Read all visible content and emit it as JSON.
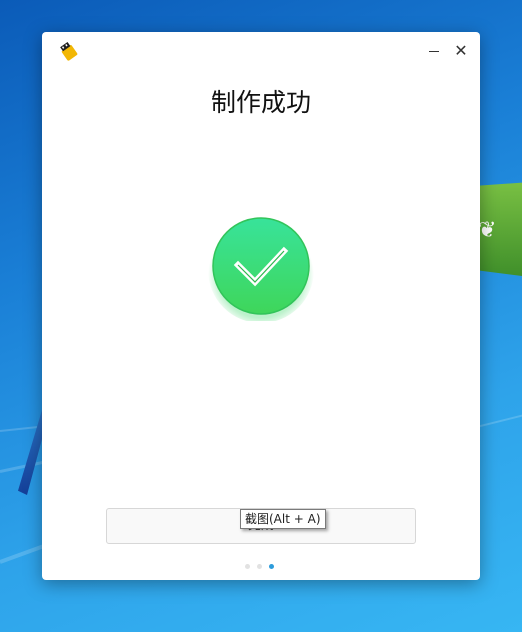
{
  "window": {
    "title": "制作成功",
    "app_icon": "usb-drive-icon",
    "minimize_icon": "minimize-icon",
    "close_icon": "close-icon",
    "close_glyph": "✕"
  },
  "status": {
    "icon": "check-circle-icon",
    "color": "#3fd86c"
  },
  "actions": {
    "complete_label": "完成"
  },
  "tooltip": {
    "text": "截图(Alt + A)"
  },
  "pagination": {
    "total": 3,
    "active_index": 2,
    "active_color": "#2d9cdb",
    "inactive_color": "#e2e2e2"
  },
  "desktop": {
    "decorations": [
      "green-flag",
      "butterfly-icon",
      "blue-shard"
    ]
  }
}
